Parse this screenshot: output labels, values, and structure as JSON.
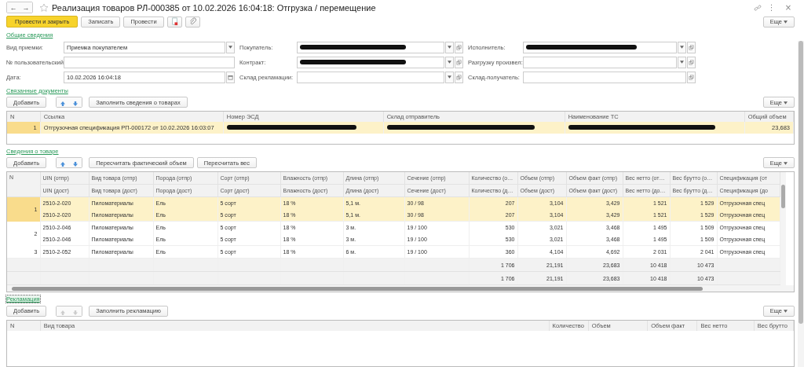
{
  "window": {
    "title": "Реализация товаров РЛ-000385 от 10.02.2026 16:04:18: Отгрузка / перемещение",
    "back": "←",
    "forward": "→",
    "more": "⋮",
    "close": "×"
  },
  "toolbar": {
    "buttons": [
      {
        "label": "Провести и закрыть",
        "kind": "default"
      },
      {
        "label": "Записать",
        "kind": "plain"
      },
      {
        "label": "Провести",
        "kind": "plain"
      },
      {
        "kind": "report"
      },
      {
        "kind": "attach"
      }
    ],
    "more": "Еще"
  },
  "general": {
    "heading": "Общие сведения",
    "columns": [
      [
        {
          "label": "Вид приемки:",
          "value": "Приемка покупателем",
          "kind": "choice"
        },
        {
          "label": "№ пользовательский:",
          "kind": "text"
        },
        {
          "label": "Дата:",
          "value": "10.02.2026 16:04:18",
          "kind": "date"
        }
      ],
      [
        {
          "label": "Покупатель:",
          "redacted": true,
          "kind": "link"
        },
        {
          "label": "Контракт:",
          "redacted": true,
          "kind": "link"
        },
        {
          "label": "Склад рекламации:",
          "kind": "link"
        }
      ],
      [
        {
          "label": "Исполнитель:",
          "redacted": true,
          "kind": "link"
        },
        {
          "label": "Разгрузку произвел:",
          "kind": "link"
        },
        {
          "label": "Склад-получатель:",
          "kind": "ref"
        }
      ]
    ]
  },
  "linked": {
    "heading": "Связанные документы",
    "focused": false,
    "add": "Добавить",
    "move_enabled": true,
    "actions": [
      "Заполнить сведения о товарах"
    ],
    "more": "Еще",
    "columns": [
      "N",
      "Ссылка",
      "Номер ЭСД",
      "Склад отправитель",
      "Наименование ТС",
      "Общий объем"
    ],
    "rows": [
      {
        "selected": true,
        "cells": [
          {
            "text": "1"
          },
          {
            "text": "Отгрузочная спецификация РП-000172 от 10.02.2026 16:03:07"
          },
          {
            "redacted": true
          },
          {
            "redacted": true
          },
          {
            "redacted": true
          },
          {
            "text": "23,683"
          }
        ]
      }
    ]
  },
  "goods": {
    "heading": "Сведения о товаре",
    "focused": false,
    "add": "Добавить",
    "move_enabled": true,
    "actions": [
      "Пересчитать фактический объем",
      "Пересчитать вес"
    ],
    "more": "Еще",
    "number_header": "N",
    "columns": [
      {
        "otpr": "UIN (отпр)",
        "dost": "UIN (дост)"
      },
      {
        "otpr": "Вид товара (отпр)",
        "dost": "Вид товара (дост)"
      },
      {
        "otpr": "Порода (отпр)",
        "dost": "Порода (дост)"
      },
      {
        "otpr": "Сорт (отпр)",
        "dost": "Сорт (дост)"
      },
      {
        "otpr": "Влажность (отпр)",
        "dost": "Влажность (дост)"
      },
      {
        "otpr": "Длина (отпр)",
        "dost": "Длина (дост)"
      },
      {
        "otpr": "Сечение (отпр)",
        "dost": "Сечение (дост)"
      },
      {
        "otpr": "Количество (о…",
        "dost": "Количество (д…"
      },
      {
        "otpr": "Объем (отпр)",
        "dost": "Объем (дост)"
      },
      {
        "otpr": "Объем факт (отпр)",
        "dost": "Объем факт (дост)"
      },
      {
        "otpr": "Вес нетто (от…",
        "dost": "Вес нетто (до…"
      },
      {
        "otpr": "Вес брутто (о…",
        "dost": "Вес брутто (д…"
      },
      {
        "otpr": "Спецификация (от",
        "dost": "Спецификация (до"
      }
    ],
    "rows": [
      {
        "n": "1",
        "selected": true,
        "lines": [
          [
            "2510-2-020",
            "Пиломатериалы",
            "Ель",
            "5 сорт",
            "18 %",
            "5,1 м.",
            "30 / 98",
            "207",
            "3,104",
            "3,429",
            "1 521",
            "1 529",
            "Отгрузочная спец"
          ],
          [
            "2510-2-020",
            "Пиломатериалы",
            "Ель",
            "5 сорт",
            "18 %",
            "5,1 м.",
            "30 / 98",
            "207",
            "3,104",
            "3,429",
            "1 521",
            "1 529",
            "Отгрузочная спец"
          ]
        ]
      },
      {
        "n": "2",
        "selected": false,
        "lines": [
          [
            "2510-2-046",
            "Пиломатериалы",
            "Ель",
            "5 сорт",
            "18 %",
            "3 м.",
            "19 / 100",
            "530",
            "3,021",
            "3,468",
            "1 495",
            "1 509",
            "Отгрузочная спец"
          ],
          [
            "2510-2-046",
            "Пиломатериалы",
            "Ель",
            "5 сорт",
            "18 %",
            "3 м.",
            "19 / 100",
            "530",
            "3,021",
            "3,468",
            "1 495",
            "1 509",
            "Отгрузочная спец"
          ]
        ]
      },
      {
        "n": "3",
        "selected": false,
        "lines": [
          [
            "2510-2-052",
            "Пиломатериалы",
            "Ель",
            "5 сорт",
            "18 %",
            "6 м.",
            "19 / 100",
            "360",
            "4,104",
            "4,692",
            "2 031",
            "2 041",
            "Отгрузочная спец"
          ]
        ]
      }
    ],
    "totals": [
      [
        "1 706",
        "21,191",
        "23,683",
        "10 418",
        "10 473"
      ],
      [
        "1 706",
        "21,191",
        "23,683",
        "10 418",
        "10 473"
      ]
    ]
  },
  "reclamation": {
    "heading": "Рекламация",
    "focused": true,
    "add": "Добавить",
    "move_enabled": false,
    "actions": [
      "Заполнить рекламацию"
    ],
    "more": "Еще",
    "columns": [
      "N",
      "Вид товара",
      "Количество",
      "Объем",
      "Объем факт",
      "Вес нетто",
      "Вес брутто"
    ]
  }
}
